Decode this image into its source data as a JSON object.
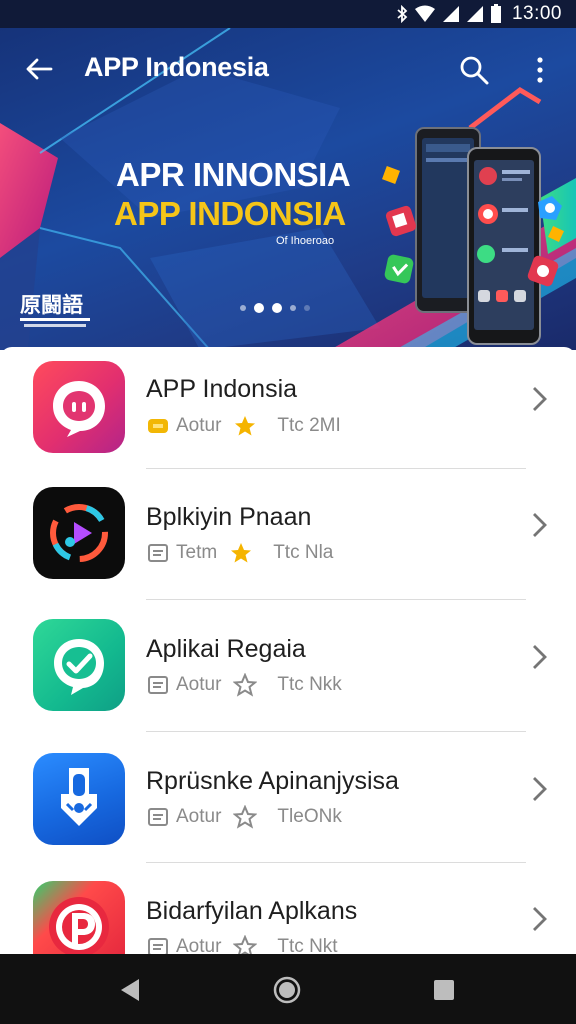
{
  "status_bar": {
    "time": "13:00",
    "icons": [
      "bluetooth-icon",
      "wifi-icon",
      "signal-icon",
      "signal-icon",
      "battery-icon"
    ]
  },
  "app_bar": {
    "title": "APP Indonesia",
    "back_icon": "arrow-left-icon",
    "search_icon": "search-icon",
    "more_icon": "more-vert-icon"
  },
  "banner": {
    "line1": "APR INNONSIA",
    "line2": "APP INDONSIA",
    "subtitle": "Of Ihoeroao",
    "logo_text": "原闘語",
    "dots_total": 4,
    "dots_active": 1,
    "colors": {
      "line2": "#f5c518",
      "accent_red": "#e2374f",
      "accent_green": "#35c759"
    }
  },
  "apps": [
    {
      "name": "APP Indonsia",
      "tag": "Aotur",
      "rating_label": "Ttc 2MI",
      "icon": "chat-bubble-icon",
      "badge_icon": "badge-yellow-icon",
      "star": "star-filled-icon"
    },
    {
      "name": "Bplkiyin Pnaan",
      "tag": "Tetm",
      "rating_label": "Ttc Nla",
      "icon": "music-play-icon",
      "badge_icon": "badge-outline-icon",
      "star": "star-filled-icon"
    },
    {
      "name": "Aplikai Regaia",
      "tag": "Aotur",
      "rating_label": "Ttc Nkk",
      "icon": "check-bubble-icon",
      "badge_icon": "badge-outline-icon",
      "star": "star-outline-icon"
    },
    {
      "name": "Rprüsnke Apinanjysisa",
      "tag": "Aotur",
      "rating_label": "TleONk",
      "icon": "shield-lock-icon",
      "badge_icon": "badge-outline-icon",
      "star": "star-outline-icon"
    },
    {
      "name": "Bidarfyilan Aplkans",
      "tag": "Aotur",
      "rating_label": "Ttc Nkt",
      "icon": "p-logo-icon",
      "badge_icon": "badge-outline-icon",
      "star": "star-outline-icon"
    }
  ],
  "nav_bar": {
    "back": "nav-back-icon",
    "home": "nav-home-icon",
    "recents": "nav-recents-icon"
  }
}
